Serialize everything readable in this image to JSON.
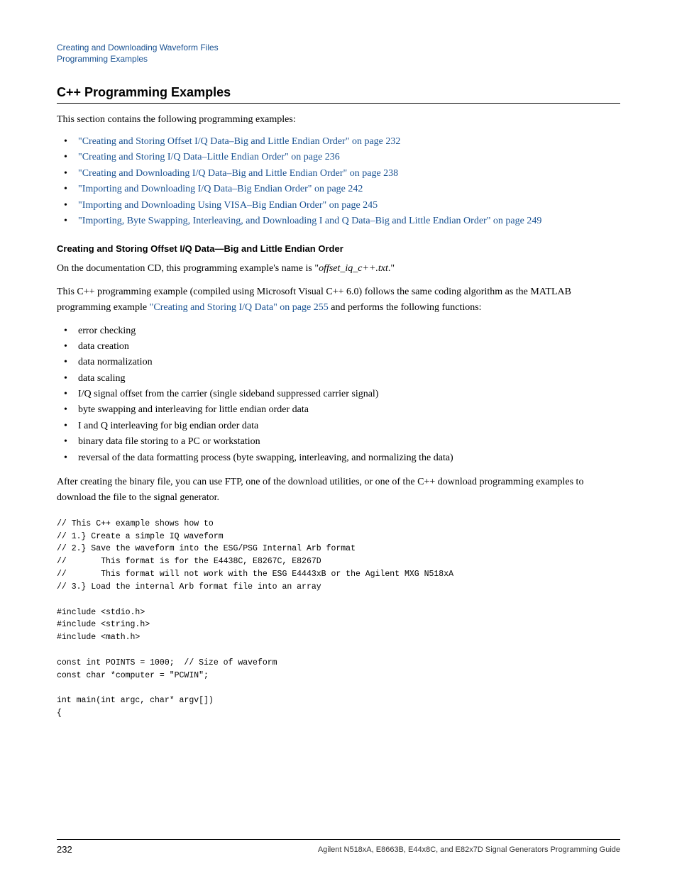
{
  "breadcrumb": {
    "line1": "Creating and Downloading Waveform Files",
    "line2": "Programming Examples",
    "line1_href": "#",
    "line2_href": "#"
  },
  "section": {
    "heading": "C++ Programming Examples",
    "intro": "This section contains the following programming examples:"
  },
  "links": [
    {
      "text": "\"Creating and Storing Offset I/Q Data–Big and Little Endian Order\" on page 232",
      "href": "#"
    },
    {
      "text": "\"Creating and Storing I/Q Data–Little Endian Order\" on page 236",
      "href": "#"
    },
    {
      "text": "\"Creating and Downloading I/Q Data–Big and Little Endian Order\" on page 238",
      "href": "#"
    },
    {
      "text": "\"Importing and Downloading I/Q Data–Big Endian Order\" on page 242",
      "href": "#"
    },
    {
      "text": "\"Importing and Downloading Using VISA–Big Endian Order\" on page 245",
      "href": "#"
    },
    {
      "text": "\"Importing, Byte Swapping, Interleaving, and Downloading I and Q Data–Big and Little Endian Order\" on page 249",
      "href": "#"
    }
  ],
  "subsection": {
    "heading": "Creating and Storing Offset I/Q Data—Big and Little Endian Order",
    "para1": "On the documentation CD, this programming example's name is \"",
    "para1_italic": "offset_iq_c++.txt",
    "para1_end": ".\"",
    "para2_start": "This C++ programming example (compiled using Microsoft Visual C++ 6.0) follows the same coding algorithm as the MATLAB programming example ",
    "para2_link": "\"Creating and Storing I/Q Data\" on page 255",
    "para2_link_href": "#",
    "para2_end": " and performs the following functions:"
  },
  "functions_list": [
    "error checking",
    "data creation",
    "data normalization",
    "data scaling",
    "I/Q signal offset from the carrier (single sideband suppressed carrier signal)",
    "byte swapping and interleaving for little endian order data",
    "I and Q interleaving for big endian order data",
    "binary data file storing to a PC or workstation",
    "reversal of the data formatting process (byte swapping, interleaving, and normalizing the data)"
  ],
  "after_list_text": "After creating the binary file, you can use FTP, one of the download utilities, or one of the C++ download programming examples to download the file to the signal generator.",
  "code": "// This C++ example shows how to\n// 1.} Create a simple IQ waveform\n// 2.} Save the waveform into the ESG/PSG Internal Arb format\n//       This format is for the E4438C, E8267C, E8267D\n//       This format will not work with the ESG E4443xB or the Agilent MXG N518xA\n// 3.} Load the internal Arb format file into an array\n\n#include <stdio.h>\n#include <string.h>\n#include <math.h>\n\nconst int POINTS = 1000;  // Size of waveform\nconst char *computer = \"PCWIN\";\n\nint main(int argc, char* argv[])\n{",
  "footer": {
    "page_number": "232",
    "title": "Agilent N518xA, E8663B, E44x8C, and E82x7D Signal Generators Programming Guide"
  }
}
